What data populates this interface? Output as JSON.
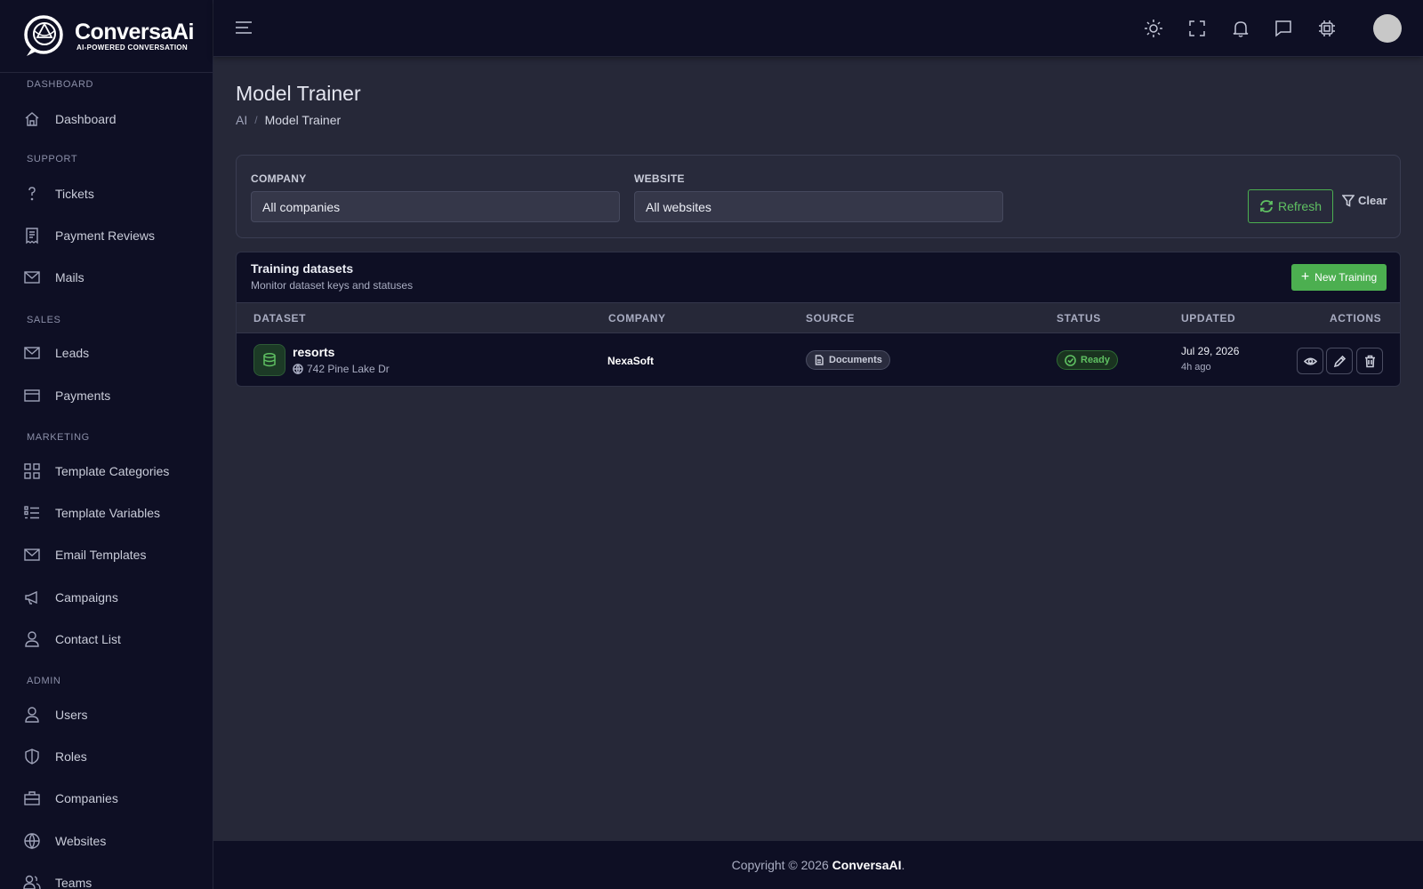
{
  "brand": {
    "name": "ConversaAi",
    "tagline": "AI-POWERED CONVERSATION"
  },
  "sidebar": {
    "sections": [
      {
        "title": "DASHBOARD",
        "items": [
          {
            "label": "Dashboard",
            "icon": "home-icon"
          }
        ]
      },
      {
        "title": "SUPPORT",
        "items": [
          {
            "label": "Tickets",
            "icon": "question-icon"
          },
          {
            "label": "Payment Reviews",
            "icon": "receipt-icon"
          },
          {
            "label": "Mails",
            "icon": "mail-icon"
          }
        ]
      },
      {
        "title": "SALES",
        "items": [
          {
            "label": "Leads",
            "icon": "mail-icon"
          },
          {
            "label": "Payments",
            "icon": "credit-card-icon"
          }
        ]
      },
      {
        "title": "MARKETING",
        "items": [
          {
            "label": "Template Categories",
            "icon": "grid-icon"
          },
          {
            "label": "Template Variables",
            "icon": "list-icon"
          },
          {
            "label": "Email Templates",
            "icon": "mail-icon"
          },
          {
            "label": "Campaigns",
            "icon": "megaphone-icon"
          },
          {
            "label": "Contact List",
            "icon": "user-icon"
          }
        ]
      },
      {
        "title": "ADMIN",
        "items": [
          {
            "label": "Users",
            "icon": "user-icon"
          },
          {
            "label": "Roles",
            "icon": "shield-icon"
          },
          {
            "label": "Companies",
            "icon": "briefcase-icon"
          },
          {
            "label": "Websites",
            "icon": "globe-icon"
          },
          {
            "label": "Teams",
            "icon": "users-icon"
          }
        ]
      }
    ]
  },
  "topbar": {
    "icons": [
      "menu-icon",
      "sun-icon",
      "fullscreen-icon",
      "bell-icon",
      "chat-icon",
      "cpu-icon",
      "avatar"
    ]
  },
  "page": {
    "title": "Model Trainer",
    "breadcrumb": {
      "parent": "AI",
      "separator": "/",
      "current": "Model Trainer"
    }
  },
  "filters": {
    "company": {
      "label": "COMPANY",
      "value": "All companies"
    },
    "website": {
      "label": "WEBSITE",
      "value": "All websites"
    },
    "refresh_label": "Refresh",
    "clear_label": "Clear"
  },
  "datasets": {
    "title": "Training datasets",
    "subtitle": "Monitor dataset keys and statuses",
    "new_button": "New Training",
    "columns": [
      "DATASET",
      "COMPANY",
      "SOURCE",
      "STATUS",
      "UPDATED",
      "ACTIONS"
    ],
    "rows": [
      {
        "name": "resorts",
        "location": "742 Pine Lake Dr",
        "company": "NexaSoft",
        "source": "Documents",
        "status": "Ready",
        "updated_date": "Jul 29, 2026",
        "updated_ago": "4h ago"
      }
    ]
  },
  "footer": {
    "prefix": "Copyright © 2026 ",
    "brand": "ConversaAI",
    "suffix": "."
  },
  "colors": {
    "accent": "#4caf50",
    "sidebar_bg": "#0e0f24",
    "main_bg": "#262838"
  }
}
